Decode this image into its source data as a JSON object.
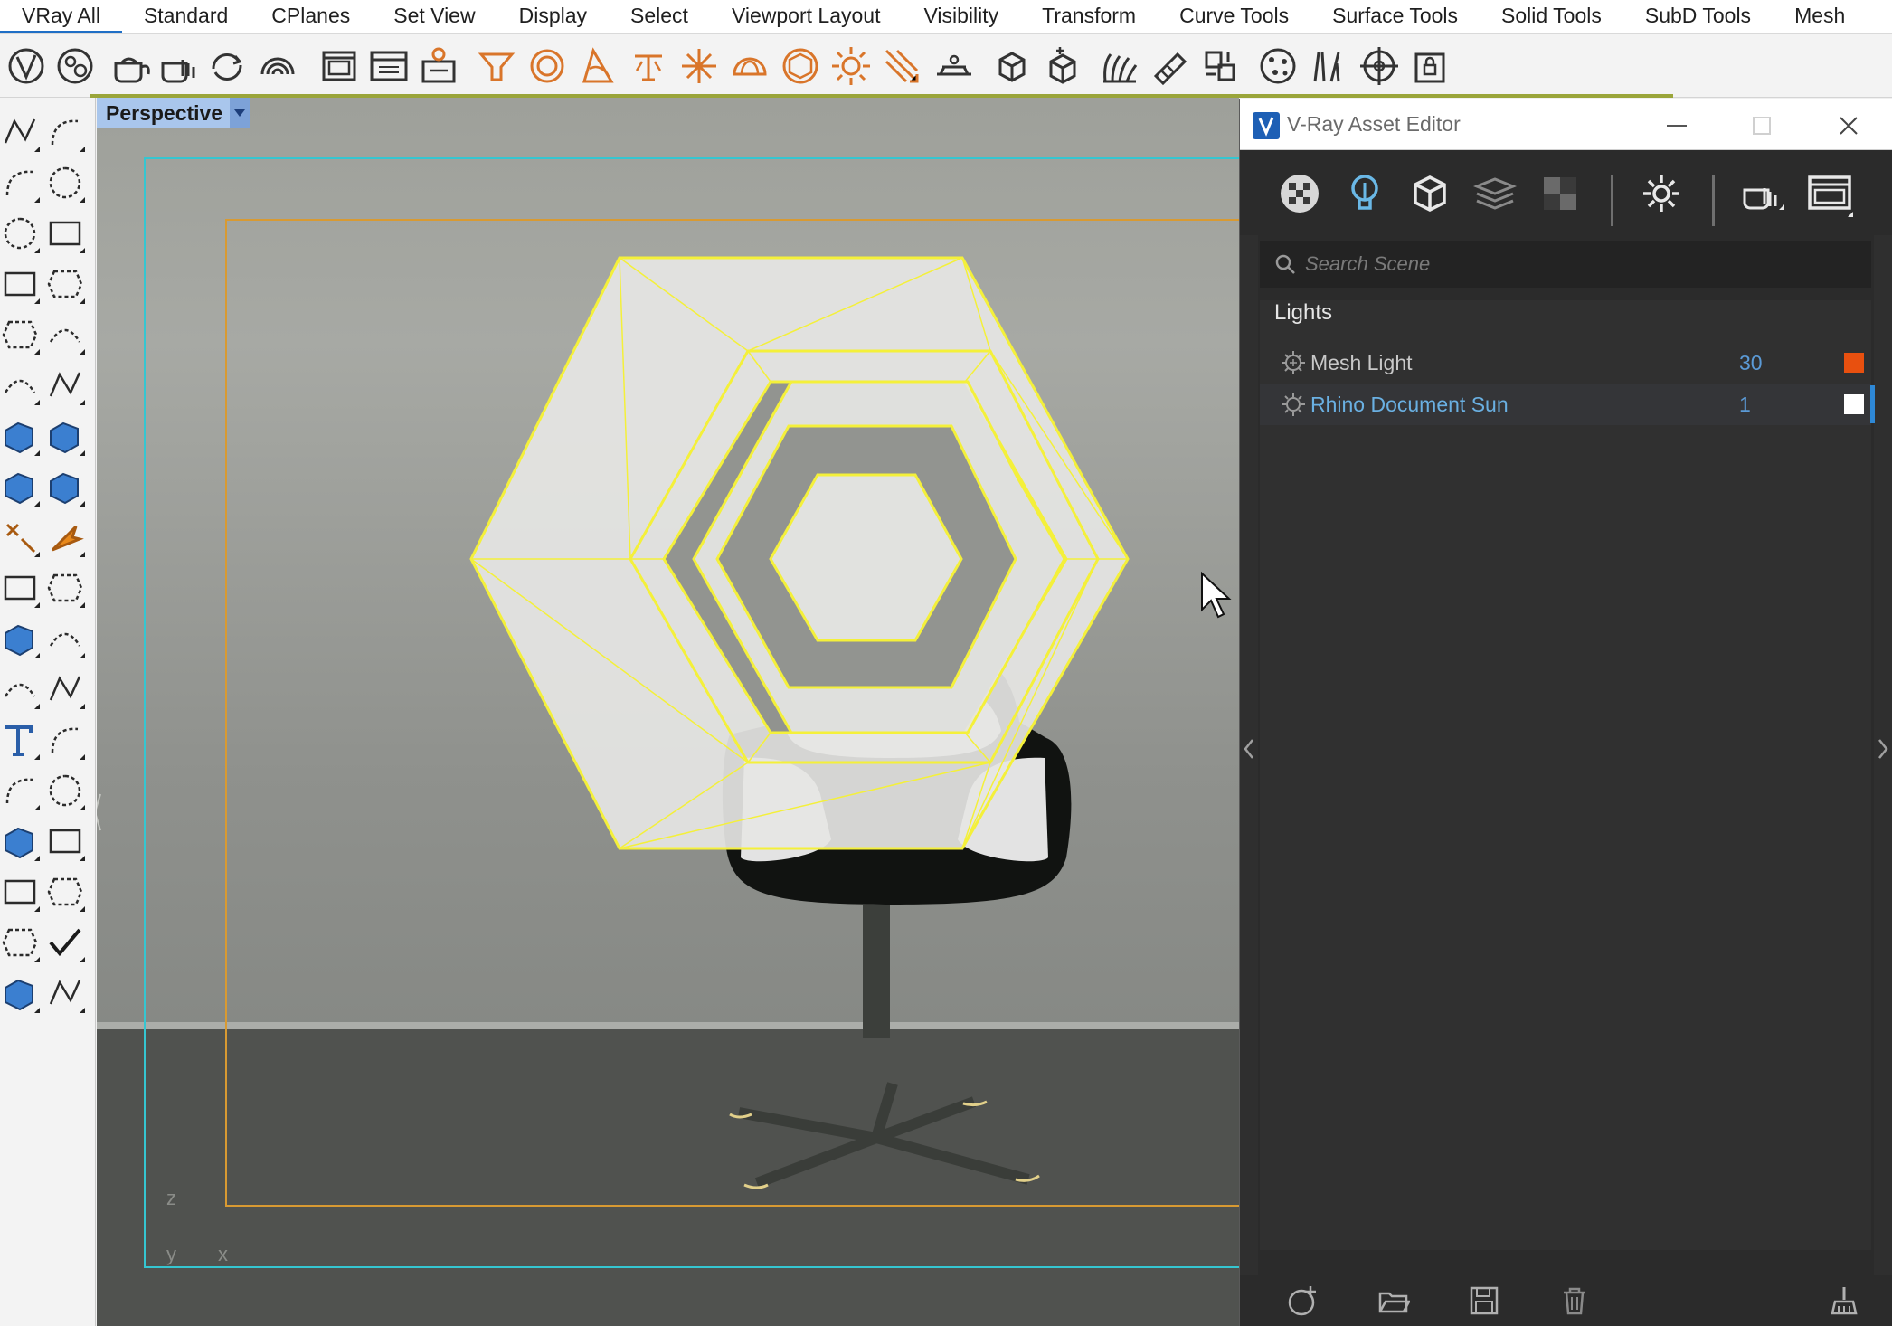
{
  "tabs": [
    "VRay All",
    "Standard",
    "CPlanes",
    "Set View",
    "Display",
    "Select",
    "Viewport Layout",
    "Visibility",
    "Transform",
    "Curve Tools",
    "Surface Tools",
    "Solid Tools",
    "SubD Tools",
    "Mesh"
  ],
  "active_tab": "VRay All",
  "viewport": {
    "label": "Perspective",
    "axis_z": "z",
    "axis_y": "y",
    "axis_x": "x"
  },
  "asset_editor": {
    "title": "V-Ray Asset Editor",
    "search_placeholder": "Search Scene",
    "section_title": "Lights",
    "lights": [
      {
        "name": "Mesh Light",
        "count": "30",
        "swatch_color": "#e8500f",
        "selected": false
      },
      {
        "name": "Rhino Document Sun",
        "count": "1",
        "swatch_color": "#ffffff",
        "selected": true
      }
    ]
  },
  "colors": {
    "accent_blue": "#1f6fc6",
    "selection_yellow": "#f4f03a",
    "frame_cyan": "#35c6d1",
    "frame_orange": "#d89a32",
    "tool_orange": "#d9752a"
  }
}
